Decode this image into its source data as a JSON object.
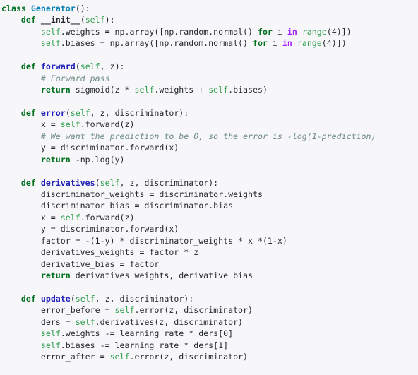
{
  "editor": {
    "language": "Python",
    "background_color": "#f7f6f8",
    "foreground_color": "#24292e",
    "font_size_px": 11.6,
    "line_height_px": 16.45,
    "indent_unit": "    ",
    "line_numbers_visible": false,
    "wrap": false
  },
  "palette": {
    "keyword": "#007020",
    "keyword_operator": "#aa22ff",
    "class_name": "#0e84b5",
    "function_name": "#2222bb",
    "self_builtin": "#2e9e4f",
    "comment": "#6d8d82",
    "text": "#24292e"
  },
  "code": {
    "title": "class Generator():",
    "plain_text": "class Generator():\n    def __init__(self):\n        self.weights = np.array([np.random.normal() for i in range(4)])\n        self.biases = np.array([np.random.normal() for i in range(4)])\n\n    def forward(self, z):\n        # Forward pass\n        return sigmoid(z * self.weights + self.biases)\n\n    def error(self, z, discriminator):\n        x = self.forward(z)\n        # We want the prediction to be 0, so the error is -log(1-prediction)\n        y = discriminator.forward(x)\n        return -np.log(y)\n\n    def derivatives(self, z, discriminator):\n        discriminator_weights = discriminator.weights\n        discriminator_bias = discriminator.bias\n        x = self.forward(z)\n        y = discriminator.forward(x)\n        factor = -(1-y) * discriminator_weights * x *(1-x)\n        derivatives_weights = factor * z\n        derivative_bias = factor\n        return derivatives_weights, derivative_bias\n\n    def update(self, z, discriminator):\n        error_before = self.error(z, discriminator)\n        ders = self.derivatives(z, discriminator)\n        self.weights -= learning_rate * ders[0]\n        self.biases -= learning_rate * ders[1]\n        error_after = self.error(z, discriminator)",
    "lines": [
      {
        "n": 1,
        "tokens": [
          {
            "t": "class",
            "c": "kw"
          },
          {
            "t": " ",
            "c": "plain"
          },
          {
            "t": "Generator",
            "c": "cls"
          },
          {
            "t": "():",
            "c": "punct"
          }
        ]
      },
      {
        "n": 2,
        "tokens": [
          {
            "t": "    ",
            "c": "plain"
          },
          {
            "t": "def",
            "c": "kw"
          },
          {
            "t": " ",
            "c": "plain"
          },
          {
            "t": "__init__",
            "c": "dunder"
          },
          {
            "t": "(",
            "c": "punct"
          },
          {
            "t": "self",
            "c": "self"
          },
          {
            "t": "):",
            "c": "punct"
          }
        ]
      },
      {
        "n": 3,
        "tokens": [
          {
            "t": "        ",
            "c": "plain"
          },
          {
            "t": "self",
            "c": "self"
          },
          {
            "t": ".weights = np.array([np.random.normal() ",
            "c": "plain"
          },
          {
            "t": "for",
            "c": "kw"
          },
          {
            "t": " i ",
            "c": "plain"
          },
          {
            "t": "in",
            "c": "op-kw"
          },
          {
            "t": " ",
            "c": "plain"
          },
          {
            "t": "range",
            "c": "builtin"
          },
          {
            "t": "(",
            "c": "punct"
          },
          {
            "t": "4",
            "c": "num"
          },
          {
            "t": ")])",
            "c": "punct"
          }
        ]
      },
      {
        "n": 4,
        "tokens": [
          {
            "t": "        ",
            "c": "plain"
          },
          {
            "t": "self",
            "c": "self"
          },
          {
            "t": ".biases = np.array([np.random.normal() ",
            "c": "plain"
          },
          {
            "t": "for",
            "c": "kw"
          },
          {
            "t": " i ",
            "c": "plain"
          },
          {
            "t": "in",
            "c": "op-kw"
          },
          {
            "t": " ",
            "c": "plain"
          },
          {
            "t": "range",
            "c": "builtin"
          },
          {
            "t": "(",
            "c": "punct"
          },
          {
            "t": "4",
            "c": "num"
          },
          {
            "t": ")])",
            "c": "punct"
          }
        ]
      },
      {
        "n": 5,
        "tokens": []
      },
      {
        "n": 6,
        "tokens": [
          {
            "t": "    ",
            "c": "plain"
          },
          {
            "t": "def",
            "c": "kw"
          },
          {
            "t": " ",
            "c": "plain"
          },
          {
            "t": "forward",
            "c": "fn"
          },
          {
            "t": "(",
            "c": "punct"
          },
          {
            "t": "self",
            "c": "self"
          },
          {
            "t": ", z):",
            "c": "punct"
          }
        ]
      },
      {
        "n": 7,
        "tokens": [
          {
            "t": "        ",
            "c": "plain"
          },
          {
            "t": "# Forward pass",
            "c": "comment"
          }
        ]
      },
      {
        "n": 8,
        "tokens": [
          {
            "t": "        ",
            "c": "plain"
          },
          {
            "t": "return",
            "c": "kw"
          },
          {
            "t": " sigmoid(z * ",
            "c": "plain"
          },
          {
            "t": "self",
            "c": "self"
          },
          {
            "t": ".weights + ",
            "c": "plain"
          },
          {
            "t": "self",
            "c": "self"
          },
          {
            "t": ".biases)",
            "c": "plain"
          }
        ]
      },
      {
        "n": 9,
        "tokens": []
      },
      {
        "n": 10,
        "tokens": [
          {
            "t": "    ",
            "c": "plain"
          },
          {
            "t": "def",
            "c": "kw"
          },
          {
            "t": " ",
            "c": "plain"
          },
          {
            "t": "error",
            "c": "fn"
          },
          {
            "t": "(",
            "c": "punct"
          },
          {
            "t": "self",
            "c": "self"
          },
          {
            "t": ", z, discriminator):",
            "c": "punct"
          }
        ]
      },
      {
        "n": 11,
        "tokens": [
          {
            "t": "        x = ",
            "c": "plain"
          },
          {
            "t": "self",
            "c": "self"
          },
          {
            "t": ".forward(z)",
            "c": "plain"
          }
        ]
      },
      {
        "n": 12,
        "tokens": [
          {
            "t": "        ",
            "c": "plain"
          },
          {
            "t": "# We want the prediction to be 0, so the error is -log(1-prediction)",
            "c": "comment"
          }
        ]
      },
      {
        "n": 13,
        "tokens": [
          {
            "t": "        y = discriminator.forward(x)",
            "c": "plain"
          }
        ]
      },
      {
        "n": 14,
        "tokens": [
          {
            "t": "        ",
            "c": "plain"
          },
          {
            "t": "return",
            "c": "kw"
          },
          {
            "t": " -np.log(y)",
            "c": "plain"
          }
        ]
      },
      {
        "n": 15,
        "tokens": []
      },
      {
        "n": 16,
        "tokens": [
          {
            "t": "    ",
            "c": "plain"
          },
          {
            "t": "def",
            "c": "kw"
          },
          {
            "t": " ",
            "c": "plain"
          },
          {
            "t": "derivatives",
            "c": "fn"
          },
          {
            "t": "(",
            "c": "punct"
          },
          {
            "t": "self",
            "c": "self"
          },
          {
            "t": ", z, discriminator):",
            "c": "punct"
          }
        ]
      },
      {
        "n": 17,
        "tokens": [
          {
            "t": "        discriminator_weights = discriminator.weights",
            "c": "plain"
          }
        ]
      },
      {
        "n": 18,
        "tokens": [
          {
            "t": "        discriminator_bias = discriminator.bias",
            "c": "plain"
          }
        ]
      },
      {
        "n": 19,
        "tokens": [
          {
            "t": "        x = ",
            "c": "plain"
          },
          {
            "t": "self",
            "c": "self"
          },
          {
            "t": ".forward(z)",
            "c": "plain"
          }
        ]
      },
      {
        "n": 20,
        "tokens": [
          {
            "t": "        y = discriminator.forward(x)",
            "c": "plain"
          }
        ]
      },
      {
        "n": 21,
        "tokens": [
          {
            "t": "        factor = -(1-y) * discriminator_weights * x *(1-x)",
            "c": "plain"
          }
        ]
      },
      {
        "n": 22,
        "tokens": [
          {
            "t": "        derivatives_weights = factor * z",
            "c": "plain"
          }
        ]
      },
      {
        "n": 23,
        "tokens": [
          {
            "t": "        derivative_bias = factor",
            "c": "plain"
          }
        ]
      },
      {
        "n": 24,
        "tokens": [
          {
            "t": "        ",
            "c": "plain"
          },
          {
            "t": "return",
            "c": "kw"
          },
          {
            "t": " derivatives_weights, derivative_bias",
            "c": "plain"
          }
        ]
      },
      {
        "n": 25,
        "tokens": []
      },
      {
        "n": 26,
        "tokens": [
          {
            "t": "    ",
            "c": "plain"
          },
          {
            "t": "def",
            "c": "kw"
          },
          {
            "t": " ",
            "c": "plain"
          },
          {
            "t": "update",
            "c": "fn"
          },
          {
            "t": "(",
            "c": "punct"
          },
          {
            "t": "self",
            "c": "self"
          },
          {
            "t": ", z, discriminator):",
            "c": "punct"
          }
        ]
      },
      {
        "n": 27,
        "tokens": [
          {
            "t": "        error_before = ",
            "c": "plain"
          },
          {
            "t": "self",
            "c": "self"
          },
          {
            "t": ".error(z, discriminator)",
            "c": "plain"
          }
        ]
      },
      {
        "n": 28,
        "tokens": [
          {
            "t": "        ders = ",
            "c": "plain"
          },
          {
            "t": "self",
            "c": "self"
          },
          {
            "t": ".derivatives(z, discriminator)",
            "c": "plain"
          }
        ]
      },
      {
        "n": 29,
        "tokens": [
          {
            "t": "        ",
            "c": "plain"
          },
          {
            "t": "self",
            "c": "self"
          },
          {
            "t": ".weights -= learning_rate * ders[",
            "c": "plain"
          },
          {
            "t": "0",
            "c": "num"
          },
          {
            "t": "]",
            "c": "punct"
          }
        ]
      },
      {
        "n": 30,
        "tokens": [
          {
            "t": "        ",
            "c": "plain"
          },
          {
            "t": "self",
            "c": "self"
          },
          {
            "t": ".biases -= learning_rate * ders[",
            "c": "plain"
          },
          {
            "t": "1",
            "c": "num"
          },
          {
            "t": "]",
            "c": "punct"
          }
        ]
      },
      {
        "n": 31,
        "tokens": [
          {
            "t": "        error_after = ",
            "c": "plain"
          },
          {
            "t": "self",
            "c": "self"
          },
          {
            "t": ".error(z, discriminator)",
            "c": "plain"
          }
        ]
      }
    ]
  }
}
